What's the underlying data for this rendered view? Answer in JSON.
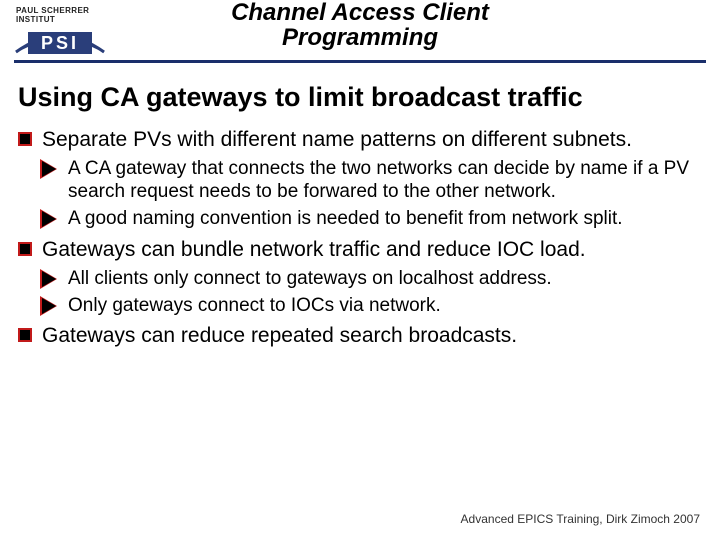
{
  "header": {
    "institute_small": "PAUL SCHERRER INSTITUT",
    "logo_text": "PSI",
    "title_line1": "Channel Access Client",
    "title_line2": "Programming"
  },
  "heading": "Using CA gateways to limit broadcast traffic",
  "bullets": [
    {
      "text": "Separate PVs with different name patterns on different subnets.",
      "sub": [
        "A CA gateway that connects the two networks can decide by name if a PV search request needs to be forwared to the other network.",
        "A good naming convention is needed to benefit from network split."
      ]
    },
    {
      "text": "Gateways can bundle network traffic and reduce IOC load.",
      "sub": [
        "All clients only connect to gateways on localhost address.",
        "Only gateways connect to IOCs via network."
      ]
    },
    {
      "text": "Gateways can reduce repeated search broadcasts.",
      "sub": []
    }
  ],
  "footer": "Advanced EPICS Training, Dirk Zimoch 2007"
}
